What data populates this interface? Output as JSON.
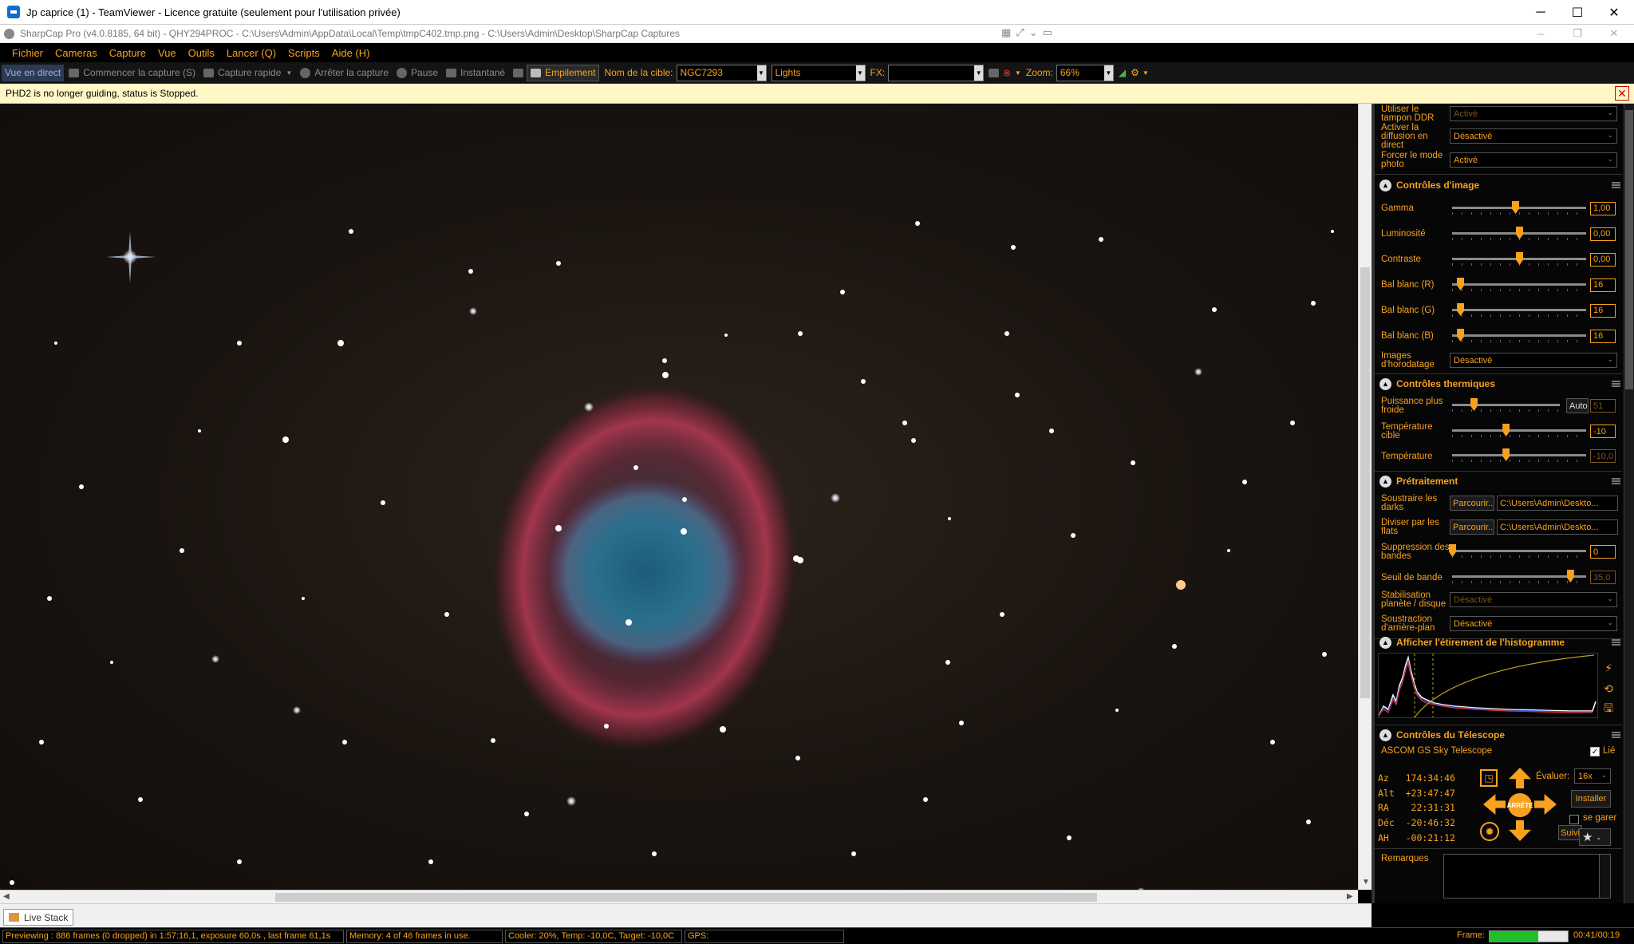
{
  "teamviewer": {
    "title": "Jp caprice (1) - TeamViewer - Licence gratuite (seulement pour l'utilisation privée)",
    "minimize": "─",
    "maximize": "☐",
    "close": "✕"
  },
  "sharpcap": {
    "title": "SharpCap Pro (v4.0.8185, 64 bit) - QHY294PROC - C:\\Users\\Admin\\AppData\\Local\\Temp\\tmpC402.tmp.png - C:\\Users\\Admin\\Desktop\\SharpCap Captures",
    "minimize": "─",
    "maximize": "❐",
    "close": "✕"
  },
  "menu": [
    "Fichier",
    "Cameras",
    "Capture",
    "Vue",
    "Outils",
    "Lancer (Q)",
    "Scripts",
    "Aide (H)"
  ],
  "toolbar": {
    "live": "Vue en direct",
    "start_capture": "Commencer la capture (S)",
    "quick_capture": "Capture rapide",
    "stop_capture": "Arrêter la capture",
    "pause": "Pause",
    "snapshot": "Instantané",
    "stacking": "Empilement",
    "target_label": "Nom de la cible:",
    "target_value": "NGC7293",
    "frame_type": "Lights",
    "fx_label": "FX:",
    "fx_value": "",
    "zoom_label": "Zoom:",
    "zoom_value": "66%"
  },
  "notice": "PHD2 is no longer guiding, status is Stopped.",
  "panel": {
    "top_rows": [
      {
        "label": "Utiliser le tampon DDR",
        "value": "Activé",
        "dim": true
      },
      {
        "label": "Activer la diffusion en direct",
        "value": "Désactivé",
        "dim": false
      },
      {
        "label": "Forcer le mode photo",
        "value": "Activé",
        "dim": false
      }
    ],
    "image_controls": {
      "title": "Contrôles d'image",
      "sliders": [
        {
          "label": "Gamma",
          "value": "1,00",
          "pos": 0.47
        },
        {
          "label": "Luminosité",
          "value": "0,00",
          "pos": 0.5
        },
        {
          "label": "Contraste",
          "value": "0,00",
          "pos": 0.5
        },
        {
          "label": "Bal blanc (R)",
          "value": "16",
          "pos": 0.06
        },
        {
          "label": "Bal blanc (G)",
          "value": "16",
          "pos": 0.06
        },
        {
          "label": "Bal blanc (B)",
          "value": "16",
          "pos": 0.06
        }
      ],
      "timestamp_label": "Images d'horodatage",
      "timestamp_value": "Désactivé"
    },
    "thermal": {
      "title": "Contrôles thermiques",
      "cooler_label": "Puissance plus froide",
      "auto": "Auto",
      "cooler_value": "51",
      "cooler_pos": 0.2,
      "target_label": "Température cible",
      "target_value": "-10",
      "target_pos": 0.4,
      "temp_label": "Température",
      "temp_value": "-10,0",
      "temp_pos": 0.4
    },
    "preprocessing": {
      "title": "Prétraitement",
      "darks_label": "Soustraire les darks",
      "browse": "Parcourir...",
      "darks_path": "C:\\Users\\Admin\\Deskto...",
      "flats_label": "Diviser par les flats",
      "flats_path": "C:\\Users\\Admin\\Deskto...",
      "banding_label": "Suppression des bandes",
      "banding_value": "0",
      "banding_pos": 0.0,
      "threshold_label": "Seuil de bande",
      "threshold_value": "35,0",
      "threshold_pos": 0.88,
      "stab_label": "Stabilisation planète / disque",
      "stab_value": "Désactivé",
      "bg_label": "Soustraction d'arrière-plan",
      "bg_value": "Désactivé"
    },
    "histogram": {
      "title": "Afficher l'étirement de l'histogramme",
      "icon_auto": "⚡",
      "icon_reset": "⟲",
      "icon_save": "🖫"
    },
    "telescope": {
      "title": "Contrôles du Télescope",
      "device": "ASCOM GS Sky Telescope",
      "linked_label": "Lié",
      "az": "Az   174:34:46",
      "alt": "Alt  +23:47:47",
      "ra": "RA    22:31:31",
      "dec": "Déc  -20:46:32",
      "ah": "AH   -00:21:12",
      "rate_label": "Évaluer:",
      "rate_value": "16x",
      "install": "Installer",
      "park": "se garer",
      "stop": "ARRÊTE",
      "track": "Suivi"
    },
    "remarks_label": "Remarques"
  },
  "tab": "Live Stack",
  "status": {
    "previewing": "Previewing : 886 frames (0 dropped) in 1:57:16,1, exposure 60,0s , last frame 61,1s",
    "memory": "Memory: 4 of 46 frames in use.",
    "cooler": "Cooler: 20%, Temp: -10,0C, Target: -10,0C",
    "gps": "GPS:",
    "frame_label": "Frame:",
    "frame_progress": 0.62,
    "time": "00:41/00:19"
  },
  "colors": {
    "accent": "#f7a21e",
    "notice_bg": "#fff8c6"
  }
}
